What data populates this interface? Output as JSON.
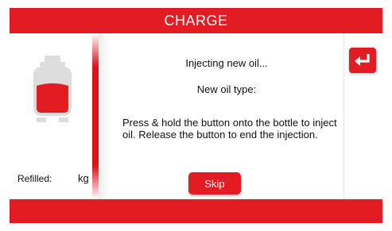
{
  "header": {
    "title": "CHARGE"
  },
  "left_panel": {
    "refilled_label": "Refilled:",
    "refilled_unit": "kg"
  },
  "main": {
    "status_line": "Injecting new oil...",
    "oil_type_label": "New oil type:",
    "instruction": "Press & hold the button onto the bottle to inject oil. Release the button to end the injection.",
    "skip_label": "Skip"
  },
  "icons": {
    "bottle": "oil-bottle-icon",
    "return": "return-arrow-icon"
  },
  "colors": {
    "brand_red": "#e31b23",
    "bottle_body": "#dcdcdc"
  }
}
